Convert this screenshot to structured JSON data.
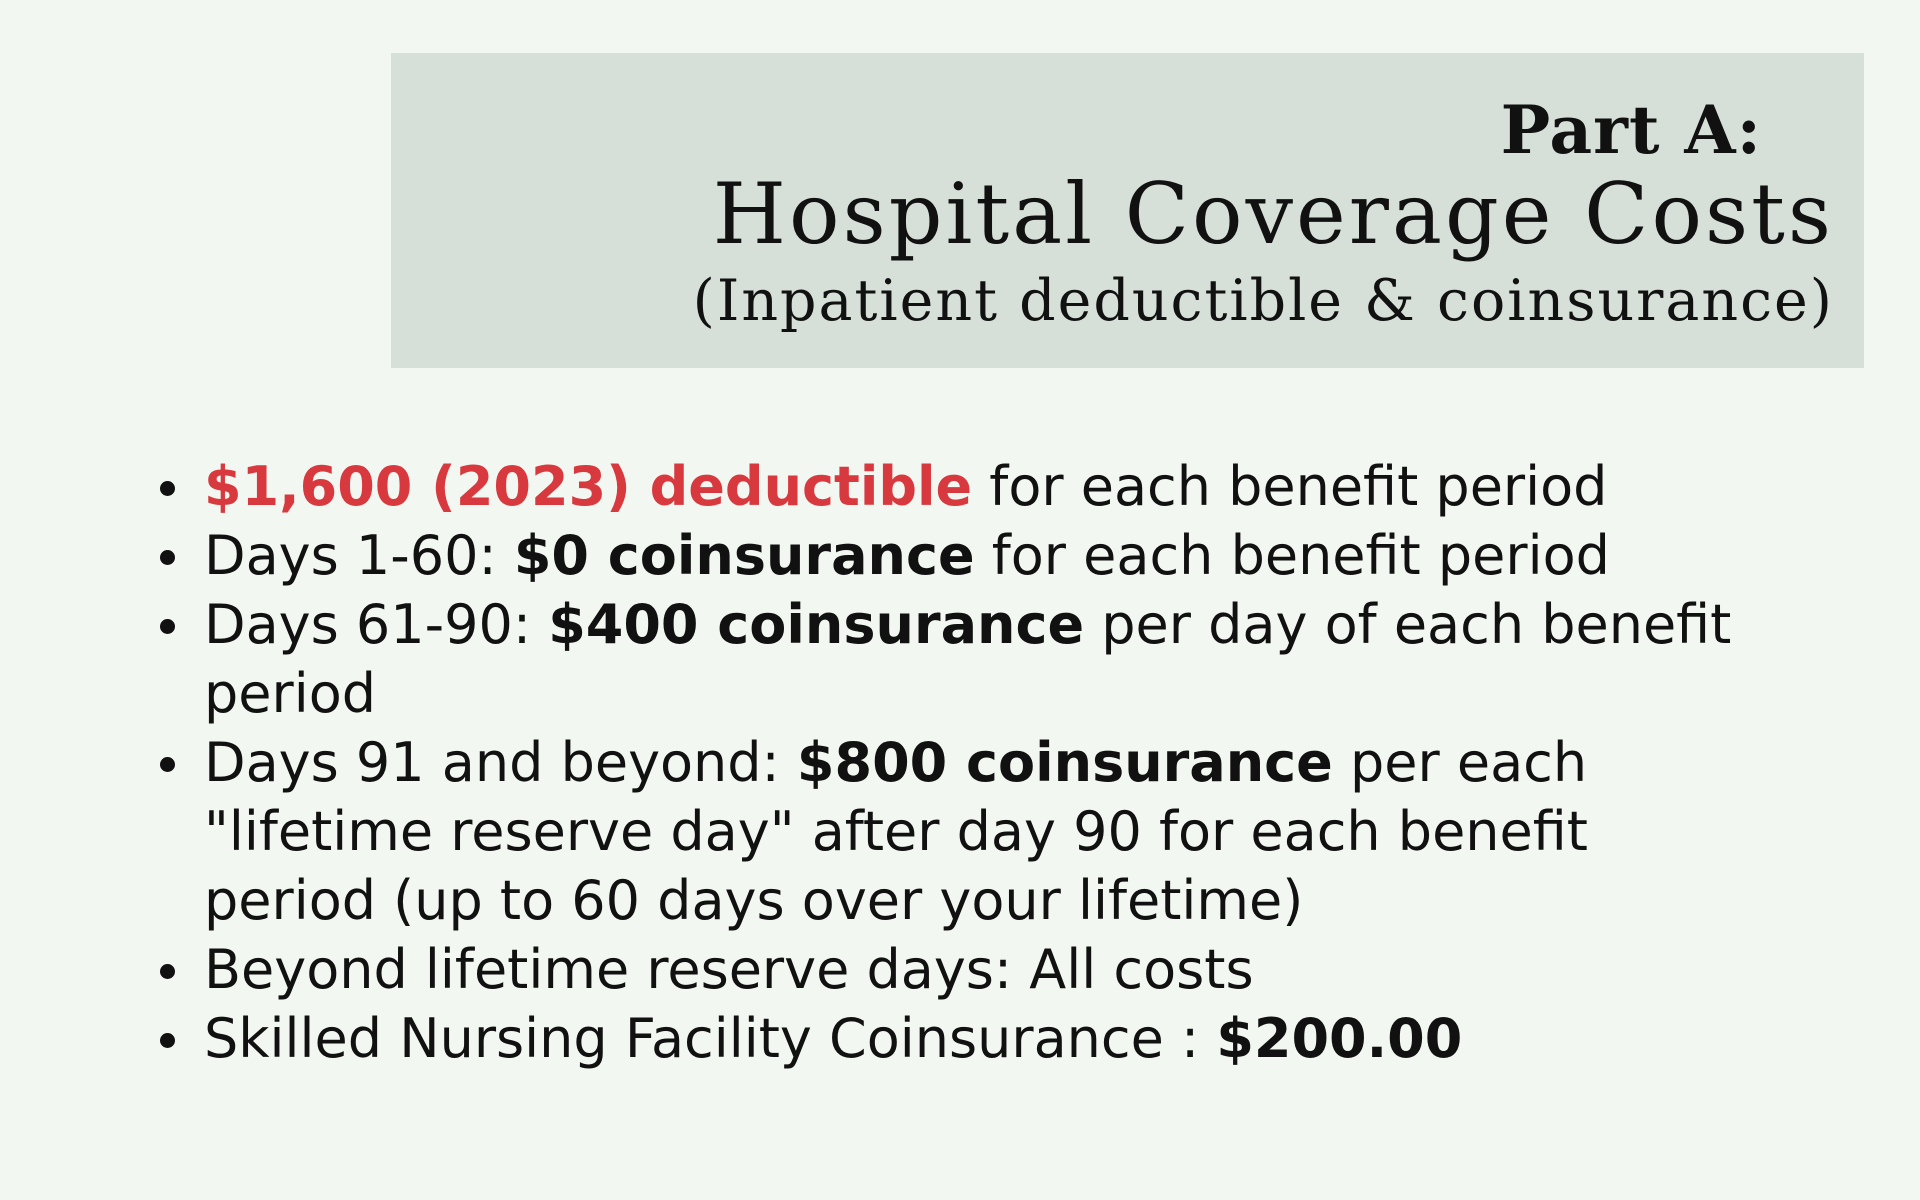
{
  "header": {
    "part_label": "Part A:",
    "title": "Hospital Coverage Costs",
    "subtitle": "(Inpatient deductible & coinsurance)"
  },
  "colors": {
    "background": "#f3f7f1",
    "header_box": "#d6e0d9",
    "text": "#111111",
    "highlight_red": "#d8393e"
  },
  "items": [
    {
      "emphasis": "$1,600 (2023) deductible",
      "rest": " for each benefit period"
    },
    {
      "prefix": "Days 1-60: ",
      "emphasis": "$0 coinsurance",
      "rest": " for each benefit period"
    },
    {
      "prefix": "Days 61-90: ",
      "emphasis": "$400 coinsurance",
      "rest": " per day of each benefit period"
    },
    {
      "prefix": "Days 91 and beyond: ",
      "emphasis": "$800 coinsurance",
      "rest": " per each \"lifetime reserve day\" after day 90 for each benefit period (up to 60 days over your lifetime)"
    },
    {
      "text": "Beyond lifetime reserve days: All costs"
    },
    {
      "prefix": "Skilled Nursing Facility Coinsurance : ",
      "emphasis": "$200.00"
    }
  ]
}
